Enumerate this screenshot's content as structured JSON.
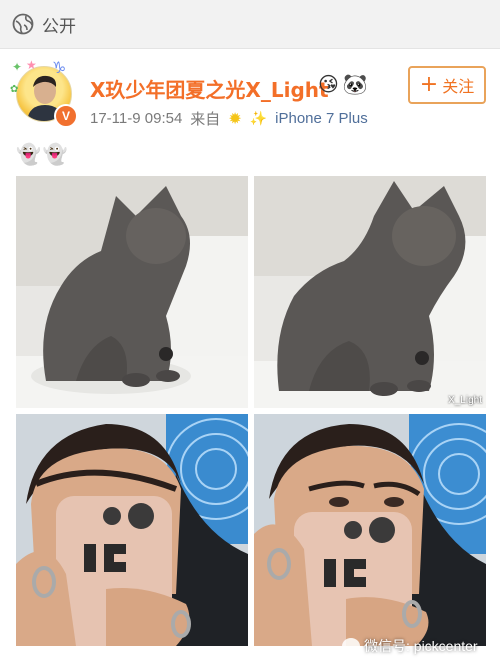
{
  "visibility": {
    "label": "公开",
    "icon": "globe-icon"
  },
  "post": {
    "author": {
      "name": "X玖少年团夏之光X_Light",
      "verified_badge": "V",
      "badges": [
        "crown-face-icon",
        "panda-icon"
      ]
    },
    "meta": {
      "date": "17-11-9 09:54",
      "source_prefix": "来自",
      "device": "iPhone 7 Plus"
    },
    "follow_button": {
      "label": "关注",
      "icon": "plus-icon"
    },
    "text": "👻👻",
    "images": [
      {
        "subject": "gray-cat-sitting"
      },
      {
        "subject": "gray-cat-sitting",
        "watermark": "X_Light"
      },
      {
        "subject": "mirror-selfie-phone"
      },
      {
        "subject": "mirror-selfie-phone"
      }
    ]
  },
  "watermark": {
    "text": "微信号: pickcenter",
    "icon": "wechat-icon"
  },
  "colors": {
    "author": "#f36f28",
    "device": "#506f9a",
    "follow_border": "#e9a35a",
    "meta": "#7a7a7a"
  }
}
